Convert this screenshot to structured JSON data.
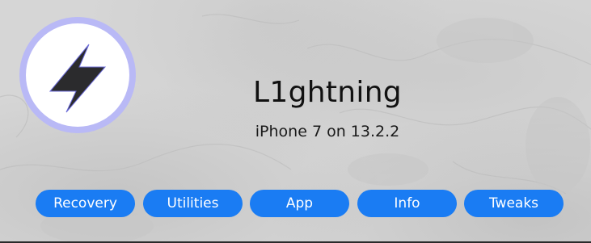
{
  "app": {
    "title": "L1ghtning",
    "device_info": "iPhone 7 on 13.2.2"
  },
  "logo": {
    "icon": "lightning-bolt-icon",
    "ring_color": "#b9b9f6",
    "bolt_color": "#2b2b2d"
  },
  "buttons": [
    {
      "label": "Recovery"
    },
    {
      "label": "Utilities"
    },
    {
      "label": "App"
    },
    {
      "label": "Info"
    },
    {
      "label": "Tweaks"
    }
  ],
  "colors": {
    "accent": "#1a7cf3",
    "background": "#d6d6d6"
  }
}
